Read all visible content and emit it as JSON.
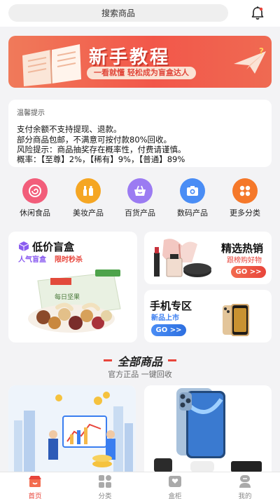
{
  "search": {
    "label": "搜索商品"
  },
  "banner": {
    "title": "新手教程",
    "subtitle": "一看就懂 轻松成为盲盒达人"
  },
  "notice": {
    "title": "温馨提示",
    "lines": [
      "支付余额不支持提现、退款。",
      "部分商品包邮，不满意可按付款80%回收。",
      "风险提示：商品抽奖存在概率性，付费请谨慎。",
      "概率：【至尊】2%，【稀有】9%，【普通】89%"
    ]
  },
  "categories": [
    {
      "label": "休闲食品",
      "icon": "candy-icon",
      "color": "#f25d7a"
    },
    {
      "label": "美妆产品",
      "icon": "makeup-icon",
      "color": "#f5a623"
    },
    {
      "label": "百货产品",
      "icon": "shopping-basket-icon",
      "color": "#9b7bf2"
    },
    {
      "label": "数码产品",
      "icon": "camera-icon",
      "color": "#4a8df5"
    },
    {
      "label": "更多分类",
      "icon": "grid-icon",
      "color": "#f5782a"
    }
  ],
  "promos": {
    "low_price": {
      "title": "低价盲盒",
      "tag1": "人气盲盒",
      "tag2": "限时秒杀",
      "box_label": "每日坚果"
    },
    "hot": {
      "title": "精选热销",
      "tag": "跟榜购好物",
      "button": "GO >>"
    },
    "phone": {
      "title": "手机专区",
      "tag": "新品上市",
      "button": "GO >>"
    }
  },
  "section": {
    "title": "全部商品",
    "subtitle": "官方正品 一键回收"
  },
  "tabs": [
    {
      "label": "首页",
      "icon": "home-icon",
      "active": true
    },
    {
      "label": "分类",
      "icon": "category-icon",
      "active": false
    },
    {
      "label": "盒柜",
      "icon": "box-cabinet-icon",
      "active": false
    },
    {
      "label": "我的",
      "icon": "user-icon",
      "active": false
    }
  ],
  "colors": {
    "accent": "#e8453b",
    "button_blue": "#3a7ef0",
    "tab_inactive": "#888888"
  }
}
